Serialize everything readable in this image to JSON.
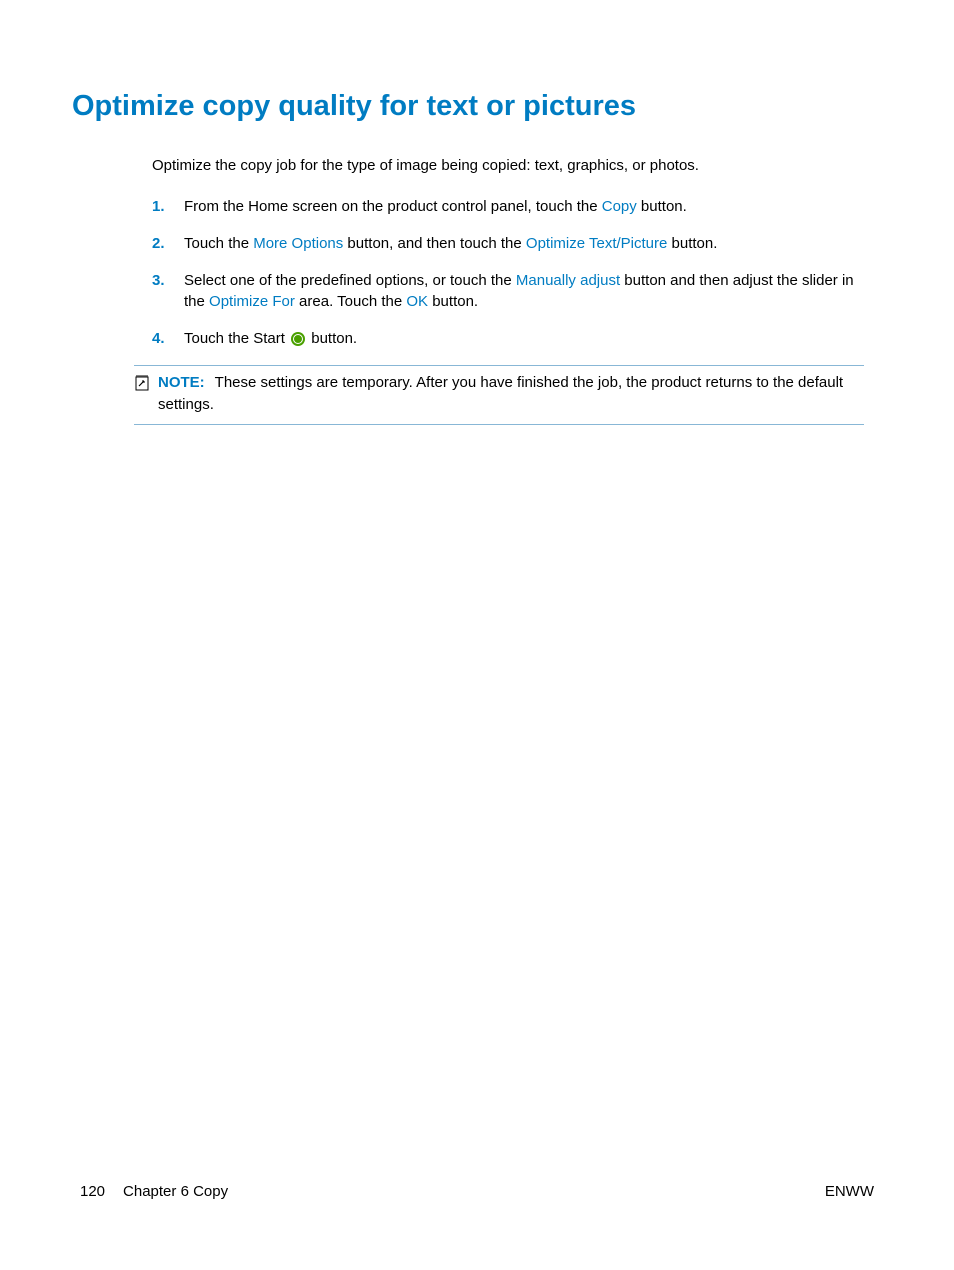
{
  "title": "Optimize copy quality for text or pictures",
  "intro": "Optimize the copy job for the type of image being copied: text, graphics, or photos.",
  "steps": [
    {
      "num": "1.",
      "parts": [
        "From the Home screen on the product control panel, touch the ",
        "Copy",
        " button."
      ]
    },
    {
      "num": "2.",
      "parts": [
        "Touch the ",
        "More Options",
        " button, and then touch the ",
        "Optimize Text/Picture",
        " button."
      ]
    },
    {
      "num": "3.",
      "parts": [
        "Select one of the predefined options, or touch the ",
        "Manually adjust",
        " button and then adjust the slider in the ",
        "Optimize For",
        " area. Touch the ",
        "OK",
        " button."
      ]
    },
    {
      "num": "4.",
      "parts": [
        "Touch the Start ",
        "__ICON__",
        " button."
      ]
    }
  ],
  "note": {
    "label": "NOTE:",
    "text": "These settings are temporary. After you have finished the job, the product returns to the default settings."
  },
  "footer": {
    "pageNum": "120",
    "chapter": "Chapter 6   Copy",
    "right": "ENWW"
  }
}
